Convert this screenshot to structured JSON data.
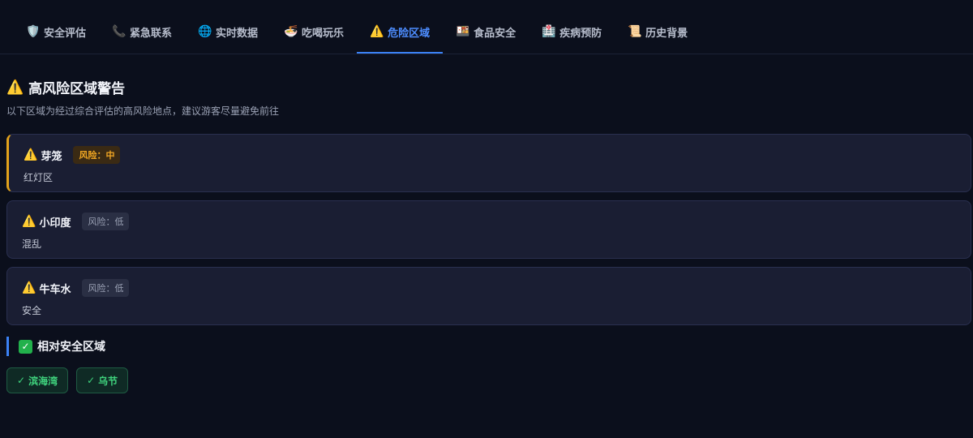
{
  "tabs": [
    {
      "label": "安全评估",
      "icon": "🛡️",
      "icon_name": "shield-icon"
    },
    {
      "label": "紧急联系",
      "icon": "📞",
      "icon_name": "phone-icon"
    },
    {
      "label": "实时数据",
      "icon": "🌐",
      "icon_name": "globe-icon"
    },
    {
      "label": "吃喝玩乐",
      "icon": "🍜",
      "icon_name": "noodle-bowl-icon"
    },
    {
      "label": "危险区域",
      "icon": "⚠️",
      "icon_name": "warning-icon",
      "active": true
    },
    {
      "label": "食品安全",
      "icon": "🍱",
      "icon_name": "bento-box-icon"
    },
    {
      "label": "疾病预防",
      "icon": "🏥",
      "icon_name": "hospital-icon"
    },
    {
      "label": "历史背景",
      "icon": "📜",
      "icon_name": "scroll-icon"
    }
  ],
  "header": {
    "icon": "⚠️",
    "title": "高风险区域警告",
    "subtitle": "以下区域为经过综合评估的高风险地点，建议游客尽量避免前往"
  },
  "zones": [
    {
      "icon": "⚠️",
      "name": "芽笼",
      "risk": "风险：中",
      "level": "medium",
      "desc": "红灯区"
    },
    {
      "icon": "⚠️",
      "name": "小印度",
      "risk": "风险：低",
      "level": "low",
      "desc": "混乱"
    },
    {
      "icon": "⚠️",
      "name": "牛车水",
      "risk": "风险：低",
      "level": "low",
      "desc": "安全"
    }
  ],
  "safe": {
    "icon": "✓",
    "title": "相对安全区域",
    "areas": [
      {
        "check": "✓",
        "name": "滨海湾"
      },
      {
        "check": "✓",
        "name": "乌节"
      }
    ]
  },
  "colors": {
    "background": "#0b0f1c",
    "accent": "#3b82f6",
    "risk_medium": "#f0a623",
    "safe": "#3fd37d"
  }
}
